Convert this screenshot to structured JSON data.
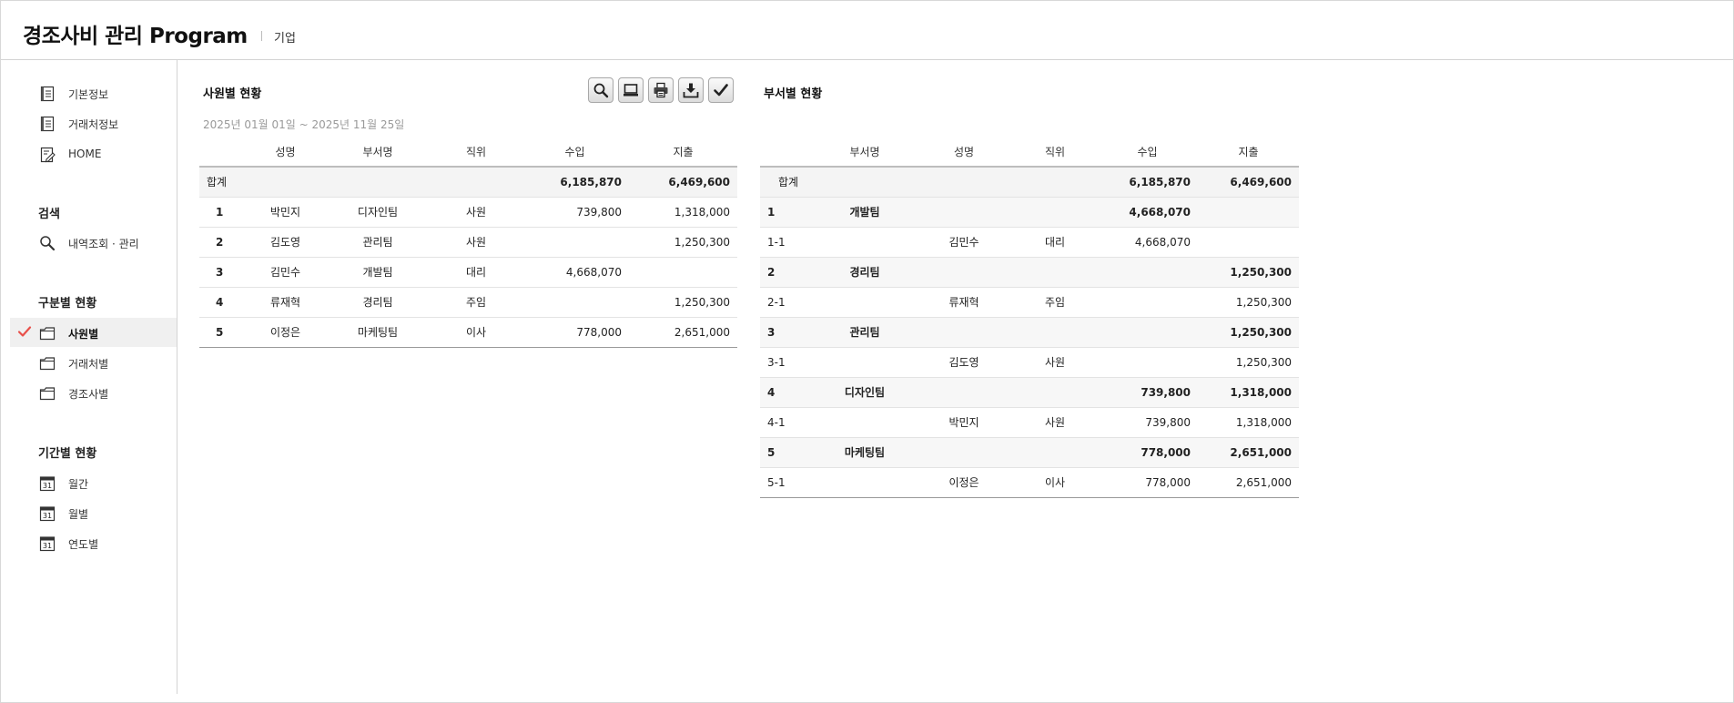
{
  "header": {
    "title": "경조사비 관리 Program",
    "subtitle": "기업"
  },
  "sidebar": {
    "top_items": [
      {
        "label": "기본정보",
        "icon": "document-icon"
      },
      {
        "label": "거래처정보",
        "icon": "document-icon"
      },
      {
        "label": "HOME",
        "icon": "edit-document-icon"
      }
    ],
    "search_heading": "검색",
    "search_item": {
      "label": "내역조회 · 관리",
      "icon": "search-icon"
    },
    "category_heading": "구분별 현황",
    "category_items": [
      {
        "label": "사원별",
        "icon": "folder-icon",
        "active": true
      },
      {
        "label": "거래처별",
        "icon": "folder-icon",
        "active": false
      },
      {
        "label": "경조사별",
        "icon": "folder-icon",
        "active": false
      }
    ],
    "period_heading": "기간별 현황",
    "period_items": [
      {
        "label": "월간",
        "icon": "calendar-icon"
      },
      {
        "label": "월별",
        "icon": "calendar-icon"
      },
      {
        "label": "연도별",
        "icon": "calendar-icon"
      }
    ],
    "calendar_day": "31"
  },
  "colors": {
    "income": "#f0892a",
    "expense": "#3aaed8",
    "active_check": "#e8504a"
  },
  "toolbar": [
    "search-icon",
    "monitor-icon",
    "print-icon",
    "download-icon",
    "check-icon"
  ],
  "employee_panel": {
    "title": "사원별 현황",
    "date_range": "2025년 01월 01일 ~ 2025년 11월 25일",
    "columns": [
      "",
      "성명",
      "부서명",
      "직위",
      "수입",
      "지출"
    ],
    "total": {
      "label": "합계",
      "income": "6,185,870",
      "expense": "6,469,600"
    },
    "rows": [
      {
        "no": "1",
        "name": "박민지",
        "dept": "디자인팀",
        "position": "사원",
        "income": "739,800",
        "expense": "1,318,000"
      },
      {
        "no": "2",
        "name": "김도영",
        "dept": "관리팀",
        "position": "사원",
        "income": "",
        "expense": "1,250,300"
      },
      {
        "no": "3",
        "name": "김민수",
        "dept": "개발팀",
        "position": "대리",
        "income": "4,668,070",
        "expense": ""
      },
      {
        "no": "4",
        "name": "류재혁",
        "dept": "경리팀",
        "position": "주임",
        "income": "",
        "expense": "1,250,300"
      },
      {
        "no": "5",
        "name": "이정은",
        "dept": "마케팅팀",
        "position": "이사",
        "income": "778,000",
        "expense": "2,651,000"
      }
    ]
  },
  "dept_panel": {
    "title": "부서별 현황",
    "columns": [
      "",
      "부서명",
      "성명",
      "직위",
      "수입",
      "지출"
    ],
    "total": {
      "label": "합계",
      "income": "6,185,870",
      "expense": "6,469,600"
    },
    "groups": [
      {
        "no": "1",
        "dept": "개발팀",
        "income": "4,668,070",
        "expense": "",
        "member": {
          "no": "1-1",
          "name": "김민수",
          "position": "대리",
          "income": "4,668,070",
          "expense": ""
        }
      },
      {
        "no": "2",
        "dept": "경리팀",
        "income": "",
        "expense": "1,250,300",
        "member": {
          "no": "2-1",
          "name": "류재혁",
          "position": "주임",
          "income": "",
          "expense": "1,250,300"
        }
      },
      {
        "no": "3",
        "dept": "관리팀",
        "income": "",
        "expense": "1,250,300",
        "member": {
          "no": "3-1",
          "name": "김도영",
          "position": "사원",
          "income": "",
          "expense": "1,250,300"
        }
      },
      {
        "no": "4",
        "dept": "디자인팀",
        "income": "739,800",
        "expense": "1,318,000",
        "member": {
          "no": "4-1",
          "name": "박민지",
          "position": "사원",
          "income": "739,800",
          "expense": "1,318,000"
        }
      },
      {
        "no": "5",
        "dept": "마케팅팀",
        "income": "778,000",
        "expense": "2,651,000",
        "member": {
          "no": "5-1",
          "name": "이정은",
          "position": "이사",
          "income": "778,000",
          "expense": "2,651,000"
        }
      }
    ]
  }
}
